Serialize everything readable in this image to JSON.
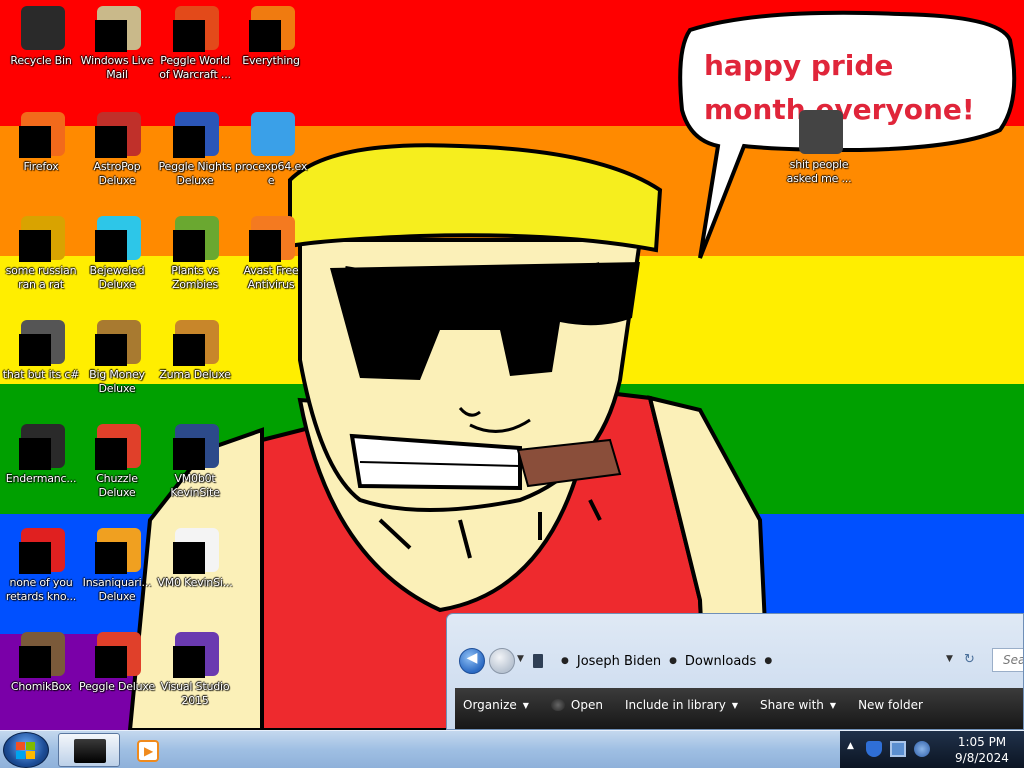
{
  "desktop": {
    "stripe_colors": [
      "#ff0000",
      "#ff8a00",
      "#ffee00",
      "#00a000",
      "#0050ff",
      "#7a00a8"
    ],
    "speech_bubble_text": "happy pride month everyone!",
    "icons": [
      {
        "label": "Recycle Bin",
        "icon": "recycle-bin-icon",
        "color": "#2a2a2a",
        "redacted": false
      },
      {
        "label": "Windows Live Mail",
        "icon": "mail-icon",
        "color": "#c9b98a",
        "redacted": true
      },
      {
        "label": "Peggle World of Warcraft ...",
        "icon": "peggle-icon",
        "color": "#e34a1a",
        "redacted": true
      },
      {
        "label": "Everything",
        "icon": "search-magnifier-icon",
        "color": "#f07b10",
        "redacted": true
      },
      {
        "label": "Firefox",
        "icon": "firefox-icon",
        "color": "#f26a1b",
        "redacted": true
      },
      {
        "label": "AstroPop Deluxe",
        "icon": "astropop-icon",
        "color": "#c0302a",
        "redacted": true
      },
      {
        "label": "Peggle Nights Deluxe",
        "icon": "peggle-nights-icon",
        "color": "#2b56b8",
        "redacted": true
      },
      {
        "label": "procexp64.exe",
        "icon": "magnifier-icon",
        "color": "#3aa0e8",
        "redacted": false
      },
      {
        "label": "some russian ran a rat",
        "icon": "document-e-icon",
        "color": "#d9a300",
        "redacted": true
      },
      {
        "label": "Bejeweled Deluxe",
        "icon": "gem-icon",
        "color": "#2dc6e8",
        "redacted": true
      },
      {
        "label": "Plants vs Zombies",
        "icon": "plant-icon",
        "color": "#6aa830",
        "redacted": true
      },
      {
        "label": "Avast Free Antivirus",
        "icon": "avast-icon",
        "color": "#f47a20",
        "redacted": true
      },
      {
        "label": "that but its c#",
        "icon": "windows-stack-icon",
        "color": "#555555",
        "redacted": true
      },
      {
        "label": "Big Money Deluxe",
        "icon": "money-bag-icon",
        "color": "#a87a30",
        "redacted": true
      },
      {
        "label": "Zuma Deluxe",
        "icon": "zuma-icon",
        "color": "#c8862a",
        "redacted": true
      },
      {
        "label": "Endermanc...",
        "icon": "terminal-icon",
        "color": "#2a2a2a",
        "redacted": true
      },
      {
        "label": "Chuzzle Deluxe",
        "icon": "chuzzle-icon",
        "color": "#e0402a",
        "redacted": true
      },
      {
        "label": "VM0b0t KevinSite",
        "icon": "vm-icon",
        "color": "#2c4a8a",
        "redacted": true
      },
      {
        "label": "none of you retards kno...",
        "icon": "red-circle-icon",
        "color": "#e02020",
        "redacted": true
      },
      {
        "label": "Insaniquari... Deluxe",
        "icon": "fish-icon",
        "color": "#f0a020",
        "redacted": true
      },
      {
        "label": "VM0 KevinSi...",
        "icon": "file-icon",
        "color": "#f4f4f4",
        "redacted": true
      },
      {
        "label": "ChomikBox",
        "icon": "hamster-box-icon",
        "color": "#7b5a3a",
        "redacted": true
      },
      {
        "label": "Peggle Deluxe",
        "icon": "peggle-deluxe-icon",
        "color": "#e0402a",
        "redacted": true
      },
      {
        "label": "Visual Studio 2015",
        "icon": "visual-studio-icon",
        "color": "#6a3ab0",
        "redacted": true
      },
      {
        "label": "shit people asked me ...",
        "icon": "folder-icon",
        "color": "#444444",
        "redacted": false
      }
    ]
  },
  "explorer": {
    "breadcrumb": [
      "Joseph Biden",
      "Downloads"
    ],
    "search_placeholder": "Sear",
    "toolbar": [
      "Organize",
      "Open",
      "Include in library",
      "Share with",
      "New folder"
    ]
  },
  "taskbar": {
    "clock_time": "1:05 PM",
    "clock_date": "9/8/2024"
  }
}
